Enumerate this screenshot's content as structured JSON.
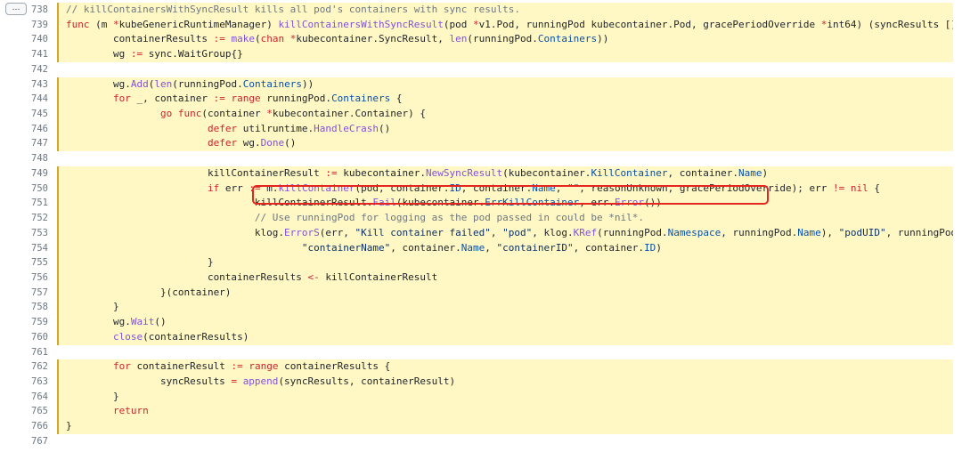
{
  "gutter_button": "…",
  "annotation_color": "#e5261f",
  "lines": [
    {
      "n": "738",
      "hl": true,
      "segs": [
        {
          "c": "cm",
          "t": "// killContainersWithSyncResult kills all pod's containers with sync results."
        }
      ]
    },
    {
      "n": "739",
      "hl": true,
      "segs": [
        {
          "c": "kw",
          "t": "func"
        },
        {
          "t": " (m "
        },
        {
          "c": "kw",
          "t": "*"
        },
        {
          "t": "kubeGenericRuntimeManager) "
        },
        {
          "c": "fn",
          "t": "killContainersWithSyncResult"
        },
        {
          "t": "(pod "
        },
        {
          "c": "kw",
          "t": "*"
        },
        {
          "t": "v1.Pod, runningPod kubecontainer.Pod, gracePeriodOverride "
        },
        {
          "c": "kw",
          "t": "*"
        },
        {
          "t": "int64) (syncResults []"
        },
        {
          "c": "kw",
          "t": "*"
        },
        {
          "t": "kubeco"
        }
      ]
    },
    {
      "n": "740",
      "hl": true,
      "segs": [
        {
          "t": "        containerResults "
        },
        {
          "c": "kw",
          "t": ":="
        },
        {
          "t": " "
        },
        {
          "c": "fn",
          "t": "make"
        },
        {
          "t": "("
        },
        {
          "c": "kw",
          "t": "chan"
        },
        {
          "t": " "
        },
        {
          "c": "kw",
          "t": "*"
        },
        {
          "t": "kubecontainer.SyncResult, "
        },
        {
          "c": "fn",
          "t": "len"
        },
        {
          "t": "(runningPod."
        },
        {
          "c": "prop",
          "t": "Containers"
        },
        {
          "t": "))"
        }
      ]
    },
    {
      "n": "741",
      "hl": true,
      "segs": [
        {
          "t": "        wg "
        },
        {
          "c": "kw",
          "t": ":="
        },
        {
          "t": " sync.WaitGroup{}"
        }
      ]
    },
    {
      "n": "742",
      "hl": true,
      "segs": []
    },
    {
      "n": "743",
      "hl": true,
      "segs": [
        {
          "t": "        wg."
        },
        {
          "c": "fn",
          "t": "Add"
        },
        {
          "t": "("
        },
        {
          "c": "fn",
          "t": "len"
        },
        {
          "t": "(runningPod."
        },
        {
          "c": "prop",
          "t": "Containers"
        },
        {
          "t": "))"
        }
      ]
    },
    {
      "n": "744",
      "hl": true,
      "segs": [
        {
          "t": "        "
        },
        {
          "c": "kw",
          "t": "for"
        },
        {
          "t": " _, container "
        },
        {
          "c": "kw",
          "t": ":="
        },
        {
          "t": " "
        },
        {
          "c": "kw",
          "t": "range"
        },
        {
          "t": " runningPod."
        },
        {
          "c": "prop",
          "t": "Containers"
        },
        {
          "t": " {"
        }
      ]
    },
    {
      "n": "745",
      "hl": true,
      "segs": [
        {
          "t": "                "
        },
        {
          "c": "kw",
          "t": "go"
        },
        {
          "t": " "
        },
        {
          "c": "kw",
          "t": "func"
        },
        {
          "t": "(container "
        },
        {
          "c": "kw",
          "t": "*"
        },
        {
          "t": "kubecontainer.Container) {"
        }
      ]
    },
    {
      "n": "746",
      "hl": true,
      "segs": [
        {
          "t": "                        "
        },
        {
          "c": "kw",
          "t": "defer"
        },
        {
          "t": " utilruntime."
        },
        {
          "c": "fn",
          "t": "HandleCrash"
        },
        {
          "t": "()"
        }
      ]
    },
    {
      "n": "747",
      "hl": true,
      "segs": [
        {
          "t": "                        "
        },
        {
          "c": "kw",
          "t": "defer"
        },
        {
          "t": " wg."
        },
        {
          "c": "fn",
          "t": "Done"
        },
        {
          "t": "()"
        }
      ]
    },
    {
      "n": "748",
      "hl": true,
      "segs": []
    },
    {
      "n": "749",
      "hl": true,
      "segs": [
        {
          "t": "                        killContainerResult "
        },
        {
          "c": "kw",
          "t": ":="
        },
        {
          "t": " kubecontainer."
        },
        {
          "c": "fn",
          "t": "NewSyncResult"
        },
        {
          "t": "(kubecontainer."
        },
        {
          "c": "prop",
          "t": "KillContainer"
        },
        {
          "t": ", container."
        },
        {
          "c": "prop",
          "t": "Name"
        },
        {
          "t": ")"
        }
      ]
    },
    {
      "n": "750",
      "hl": true,
      "segs": [
        {
          "t": "                        "
        },
        {
          "c": "kw",
          "t": "if"
        },
        {
          "t": " err "
        },
        {
          "c": "kw",
          "t": ":="
        },
        {
          "t": " m."
        },
        {
          "c": "fn",
          "t": "killContainer"
        },
        {
          "t": "(pod, container."
        },
        {
          "c": "prop",
          "t": "ID"
        },
        {
          "t": ", container."
        },
        {
          "c": "prop",
          "t": "Name"
        },
        {
          "t": ", "
        },
        {
          "c": "str",
          "t": "\"\""
        },
        {
          "t": ", reasonUnknown, gracePeriodOverride); err "
        },
        {
          "c": "kw",
          "t": "!="
        },
        {
          "t": " "
        },
        {
          "c": "kw",
          "t": "nil"
        },
        {
          "t": " {"
        }
      ]
    },
    {
      "n": "751",
      "hl": true,
      "segs": [
        {
          "t": "                                killContainerResult."
        },
        {
          "c": "fn",
          "t": "Fail"
        },
        {
          "t": "(kubecontainer."
        },
        {
          "c": "prop",
          "t": "ErrKillContainer"
        },
        {
          "t": ", err."
        },
        {
          "c": "fn",
          "t": "Error"
        },
        {
          "t": "())"
        }
      ]
    },
    {
      "n": "752",
      "hl": true,
      "segs": [
        {
          "t": "                                "
        },
        {
          "c": "cm",
          "t": "// Use runningPod for logging as the pod passed in could be *nil*."
        }
      ]
    },
    {
      "n": "753",
      "hl": true,
      "segs": [
        {
          "t": "                                klog."
        },
        {
          "c": "fn",
          "t": "ErrorS"
        },
        {
          "t": "(err, "
        },
        {
          "c": "str",
          "t": "\"Kill container failed\""
        },
        {
          "t": ", "
        },
        {
          "c": "str",
          "t": "\"pod\""
        },
        {
          "t": ", klog."
        },
        {
          "c": "fn",
          "t": "KRef"
        },
        {
          "t": "(runningPod."
        },
        {
          "c": "prop",
          "t": "Namespace"
        },
        {
          "t": ", runningPod."
        },
        {
          "c": "prop",
          "t": "Name"
        },
        {
          "t": "), "
        },
        {
          "c": "str",
          "t": "\"podUID\""
        },
        {
          "t": ", runningPod."
        },
        {
          "c": "prop",
          "t": "ID"
        },
        {
          "t": ","
        }
      ]
    },
    {
      "n": "754",
      "hl": true,
      "segs": [
        {
          "t": "                                        "
        },
        {
          "c": "str",
          "t": "\"containerName\""
        },
        {
          "t": ", container."
        },
        {
          "c": "prop",
          "t": "Name"
        },
        {
          "t": ", "
        },
        {
          "c": "str",
          "t": "\"containerID\""
        },
        {
          "t": ", container."
        },
        {
          "c": "prop",
          "t": "ID"
        },
        {
          "t": ")"
        }
      ]
    },
    {
      "n": "755",
      "hl": true,
      "segs": [
        {
          "t": "                        }"
        }
      ]
    },
    {
      "n": "756",
      "hl": true,
      "segs": [
        {
          "t": "                        containerResults "
        },
        {
          "c": "kw",
          "t": "<-"
        },
        {
          "t": " killContainerResult"
        }
      ]
    },
    {
      "n": "757",
      "hl": true,
      "segs": [
        {
          "t": "                }(container)"
        }
      ]
    },
    {
      "n": "758",
      "hl": true,
      "segs": [
        {
          "t": "        }"
        }
      ]
    },
    {
      "n": "759",
      "hl": true,
      "segs": [
        {
          "t": "        wg."
        },
        {
          "c": "fn",
          "t": "Wait"
        },
        {
          "t": "()"
        }
      ]
    },
    {
      "n": "760",
      "hl": true,
      "segs": [
        {
          "t": "        "
        },
        {
          "c": "fn",
          "t": "close"
        },
        {
          "t": "(containerResults)"
        }
      ]
    },
    {
      "n": "761",
      "hl": true,
      "segs": []
    },
    {
      "n": "762",
      "hl": true,
      "segs": [
        {
          "t": "        "
        },
        {
          "c": "kw",
          "t": "for"
        },
        {
          "t": " containerResult "
        },
        {
          "c": "kw",
          "t": ":="
        },
        {
          "t": " "
        },
        {
          "c": "kw",
          "t": "range"
        },
        {
          "t": " containerResults {"
        }
      ]
    },
    {
      "n": "763",
      "hl": true,
      "segs": [
        {
          "t": "                syncResults "
        },
        {
          "c": "kw",
          "t": "="
        },
        {
          "t": " "
        },
        {
          "c": "fn",
          "t": "append"
        },
        {
          "t": "(syncResults, containerResult)"
        }
      ]
    },
    {
      "n": "764",
      "hl": true,
      "segs": [
        {
          "t": "        }"
        }
      ]
    },
    {
      "n": "765",
      "hl": true,
      "segs": [
        {
          "t": "        "
        },
        {
          "c": "kw",
          "t": "return"
        }
      ]
    },
    {
      "n": "766",
      "hl": true,
      "segs": [
        {
          "t": "}"
        }
      ]
    },
    {
      "n": "767",
      "hl": false,
      "segs": []
    }
  ]
}
